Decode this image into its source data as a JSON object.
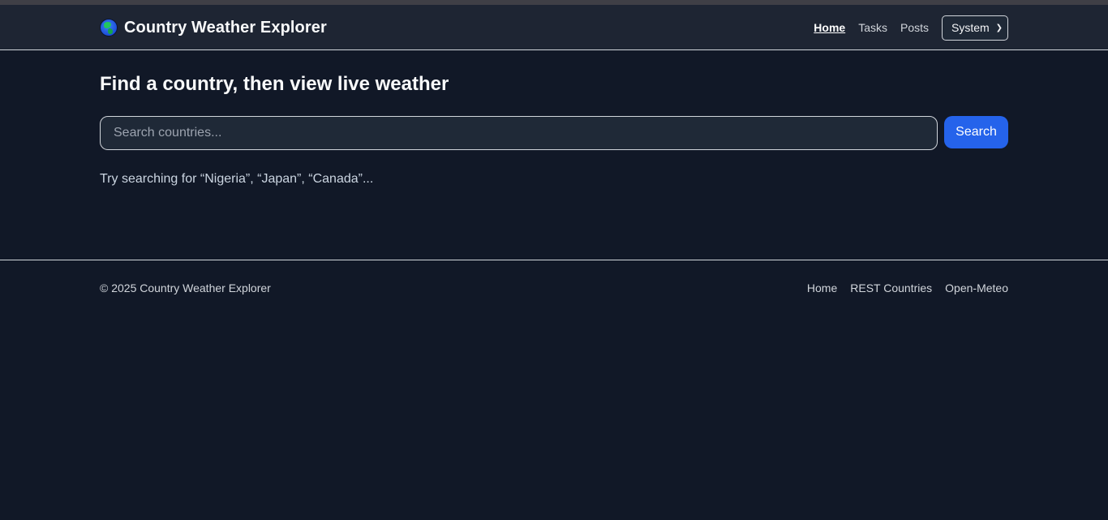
{
  "app": {
    "title": "Country Weather Explorer",
    "logo_icon": "globe-icon"
  },
  "nav": {
    "links": [
      {
        "label": "Home",
        "active": true
      },
      {
        "label": "Tasks",
        "active": false
      },
      {
        "label": "Posts",
        "active": false
      }
    ],
    "theme_select": {
      "value": "System"
    }
  },
  "main": {
    "heading": "Find a country, then view live weather",
    "search": {
      "placeholder": "Search countries...",
      "value": "",
      "button_label": "Search"
    },
    "hint": "Try searching for “Nigeria”, “Japan”, “Canada”..."
  },
  "footer": {
    "copyright": "© 2025 Country Weather Explorer",
    "links": [
      "Home",
      "REST Countries",
      "Open-Meteo"
    ]
  },
  "colors": {
    "background": "#111827",
    "navbar": "#1e2533",
    "accent": "#2563eb"
  }
}
